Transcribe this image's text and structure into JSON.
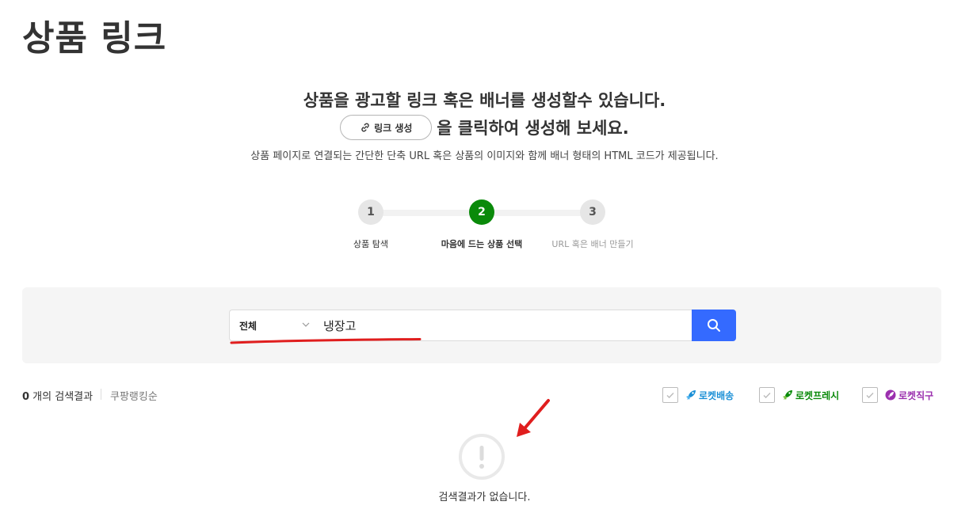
{
  "page": {
    "title": "상품 링크"
  },
  "intro": {
    "line1": "상품을 광고할 링크 혹은 배너를 생성할수 있습니다.",
    "button_label": "링크 생성",
    "line2_suffix": "을 클릭하여 생성해 보세요.",
    "line3": "상품 페이지로 연결되는 간단한 단축 URL 혹은 상품의 이미지와 함께 배너 형태의 HTML 코드가 제공됩니다."
  },
  "steps": [
    {
      "number": "1",
      "label": "상품 탐색",
      "state": "done"
    },
    {
      "number": "2",
      "label": "마음에 드는 상품 선택",
      "state": "active"
    },
    {
      "number": "3",
      "label": "URL 혹은 배너 만들기",
      "state": "pending"
    }
  ],
  "search": {
    "category": "전체",
    "query": "냉장고"
  },
  "results": {
    "count": "0",
    "count_suffix": " 개의 검색결과",
    "sort_label": "쿠팡랭킹순",
    "filters": [
      {
        "label": "로켓배송",
        "color": "#1a8fd6",
        "icon": "rocket-icon"
      },
      {
        "label": "로켓프레시",
        "color": "#0a8a0a",
        "icon": "rocket-icon"
      },
      {
        "label": "로켓직구",
        "color": "#9b2fae",
        "icon": "rocket-global-icon"
      }
    ],
    "empty_message": "검색결과가 없습니다."
  },
  "colors": {
    "accent": "#346aff",
    "step_active": "#0a8a0a",
    "annotation_red": "#e01e1e"
  }
}
